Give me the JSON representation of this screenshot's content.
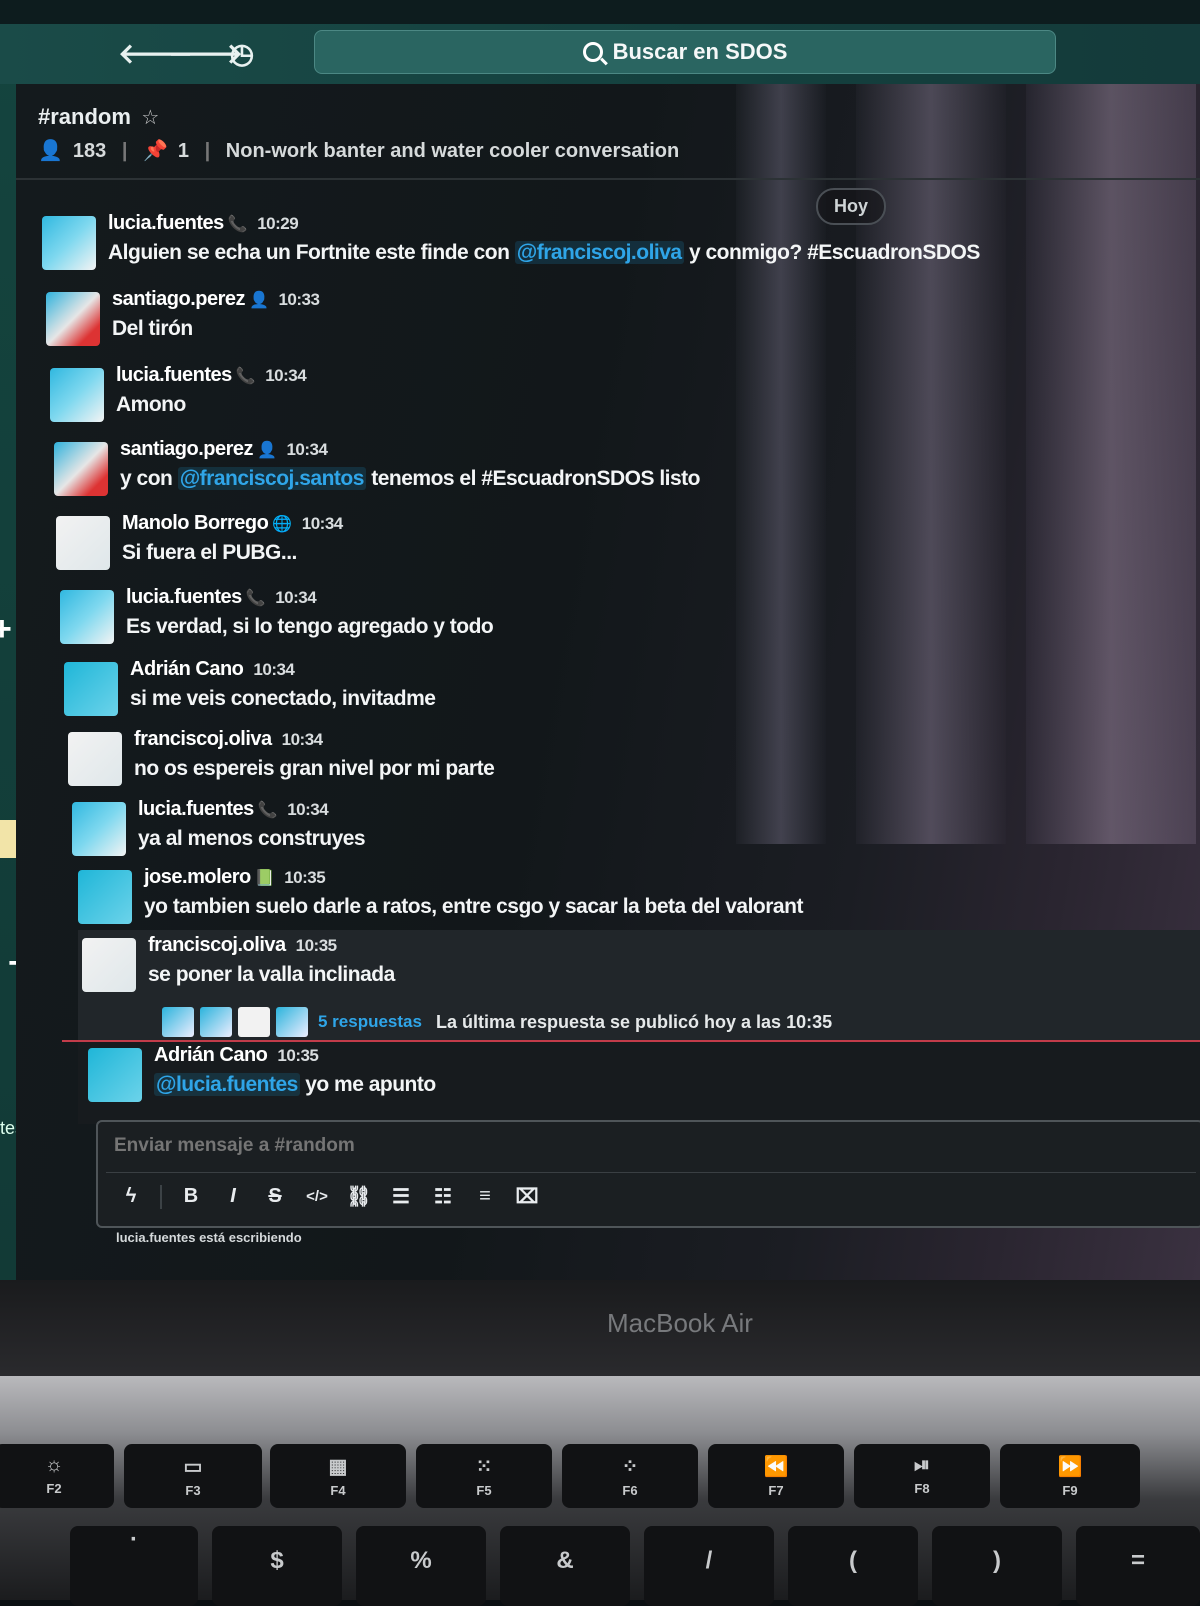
{
  "app": {
    "search_label": "Buscar en SDOS",
    "nav": {
      "back": "🡐",
      "forward": "🡒",
      "history": "◷"
    }
  },
  "channel": {
    "name": "#random",
    "members": "183",
    "pins": "1",
    "topic": "Non-work banter and water cooler conversation"
  },
  "day_divider": "Hoy",
  "messages": [
    {
      "user": "lucia.fuentes",
      "time": "10:29",
      "status_icon": "phone-icon",
      "text_before": "Alguien se echa un Fortnite este finde con ",
      "mention": "@franciscoj.oliva",
      "text_after": " y conmigo? #EscuadronSDOS"
    },
    {
      "user": "santiago.perez",
      "time": "10:33",
      "status_icon": "person-icon",
      "text": "Del tirón"
    },
    {
      "user": "lucia.fuentes",
      "time": "10:34",
      "status_icon": "phone-icon",
      "text": "Amono"
    },
    {
      "user": "santiago.perez",
      "time": "10:34",
      "status_icon": "person-icon",
      "text_before": "y con ",
      "mention": "@franciscoj.santos",
      "text_after": " tenemos el #EscuadronSDOS listo"
    },
    {
      "user": "Manolo Borrego",
      "time": "10:34",
      "status_icon": "globe-icon",
      "text": "Si fuera el PUBG..."
    },
    {
      "user": "lucia.fuentes",
      "time": "10:34",
      "status_icon": "phone-icon",
      "text": "Es verdad, si lo tengo agregado y todo"
    },
    {
      "user": "Adrián Cano",
      "time": "10:34",
      "text": "si me veis conectado, invitadme"
    },
    {
      "user": "franciscoj.oliva",
      "time": "10:34",
      "text": "no os espereis gran nivel por mi parte"
    },
    {
      "user": "lucia.fuentes",
      "time": "10:34",
      "status_icon": "phone-icon",
      "text": "ya al menos construyes"
    },
    {
      "user": "jose.molero",
      "time": "10:35",
      "status_icon": "book-icon",
      "text": "yo tambien suelo darle a ratos, entre csgo y sacar la beta del valorant"
    },
    {
      "user": "franciscoj.oliva",
      "time": "10:35",
      "text": "se poner la valla inclinada"
    },
    {
      "user": "Adrián Cano",
      "time": "10:35",
      "mention": "@lucia.fuentes",
      "text_after": " yo me apunto"
    }
  ],
  "thread": {
    "replies": "5 respuestas",
    "last_reply": "La última respuesta se publicó hoy a las 10:35"
  },
  "composer": {
    "placeholder": "Enviar mensaje a #random",
    "typing_indicator": "lucia.fuentes está escribiendo"
  },
  "sidebar": {
    "partial_text": "tes"
  },
  "laptop": {
    "brand": "MacBook Air",
    "fkeys": [
      "F2",
      "F3",
      "F4",
      "F5",
      "F6",
      "F7",
      "F8",
      "F9"
    ],
    "number_keys": [
      "$",
      "%",
      "&",
      "/",
      "(",
      ")",
      "="
    ]
  }
}
